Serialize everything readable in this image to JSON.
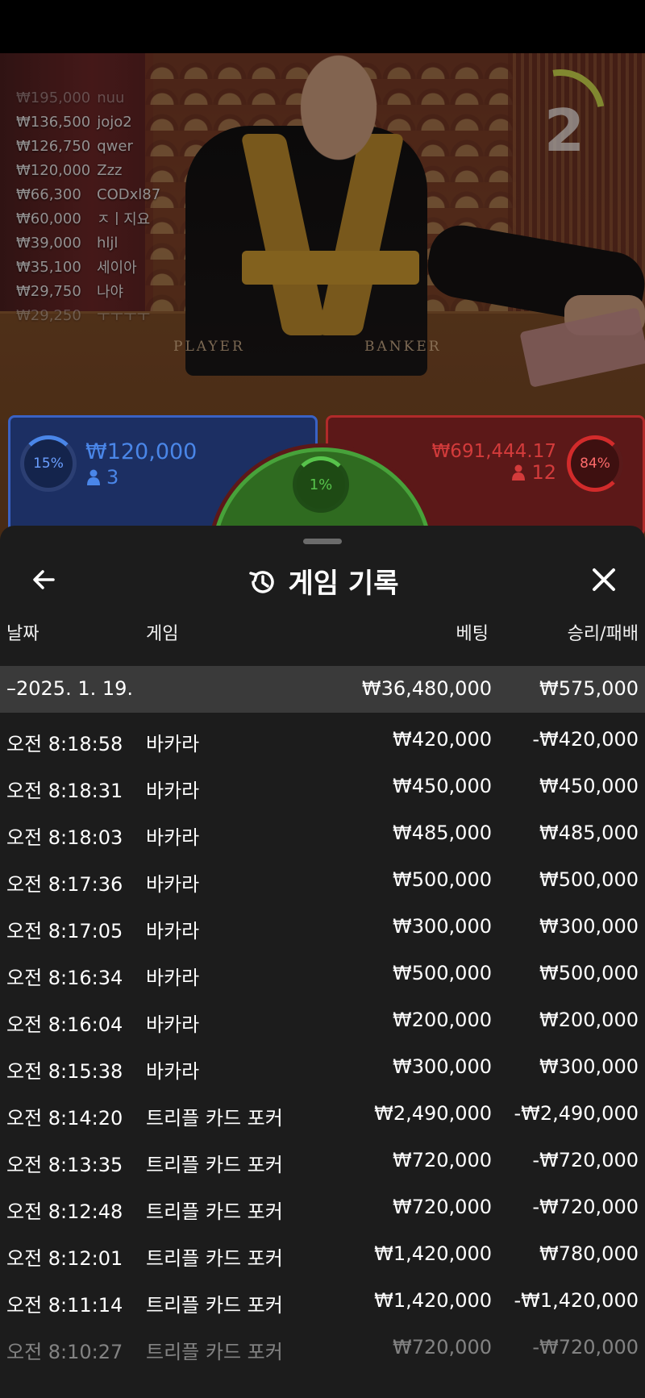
{
  "video": {
    "round_number": "2",
    "table_labels": {
      "player": "PLAYER",
      "banker": "BANKER"
    },
    "leaderboard": [
      {
        "amount": "₩195,000",
        "name": "nuu"
      },
      {
        "amount": "₩136,500",
        "name": "jojo2"
      },
      {
        "amount": "₩126,750",
        "name": "qwer"
      },
      {
        "amount": "₩120,000",
        "name": "Zzz"
      },
      {
        "amount": "₩66,300",
        "name": "CODxl87"
      },
      {
        "amount": "₩60,000",
        "name": "ㅈㅣ지요"
      },
      {
        "amount": "₩39,000",
        "name": "hljl"
      },
      {
        "amount": "₩35,100",
        "name": "세이아"
      },
      {
        "amount": "₩29,750",
        "name": "나야"
      },
      {
        "amount": "₩29,250",
        "name": "ㅜㅜㅜㅜ"
      }
    ],
    "player_panel": {
      "percent": "15%",
      "amount": "₩120,000",
      "count": "3",
      "color": "#4a86e8"
    },
    "banker_panel": {
      "percent": "84%",
      "amount": "₩691,444.17",
      "count": "12",
      "color": "#d33b3b"
    },
    "tie_panel": {
      "percent": "1%",
      "color": "#57c34b"
    }
  },
  "sheet": {
    "title": "게임 기록",
    "columns": {
      "date": "날짜",
      "game": "게임",
      "bet": "베팅",
      "win_loss": "승리/패배"
    },
    "summary": {
      "date": "–2025. 1. 19.",
      "bet": "₩36,480,000",
      "win_loss": "₩575,000"
    },
    "rows": [
      {
        "time": "오전 8:18:58",
        "game": "바카라",
        "bet": "₩420,000",
        "win_loss": "-₩420,000"
      },
      {
        "time": "오전 8:18:31",
        "game": "바카라",
        "bet": "₩450,000",
        "win_loss": "₩450,000"
      },
      {
        "time": "오전 8:18:03",
        "game": "바카라",
        "bet": "₩485,000",
        "win_loss": "₩485,000"
      },
      {
        "time": "오전 8:17:36",
        "game": "바카라",
        "bet": "₩500,000",
        "win_loss": "₩500,000"
      },
      {
        "time": "오전 8:17:05",
        "game": "바카라",
        "bet": "₩300,000",
        "win_loss": "₩300,000"
      },
      {
        "time": "오전 8:16:34",
        "game": "바카라",
        "bet": "₩500,000",
        "win_loss": "₩500,000"
      },
      {
        "time": "오전 8:16:04",
        "game": "바카라",
        "bet": "₩200,000",
        "win_loss": "₩200,000"
      },
      {
        "time": "오전 8:15:38",
        "game": "바카라",
        "bet": "₩300,000",
        "win_loss": "₩300,000"
      },
      {
        "time": "오전 8:14:20",
        "game": "트리플 카드 포커",
        "bet": "₩2,490,000",
        "win_loss": "-₩2,490,000"
      },
      {
        "time": "오전 8:13:35",
        "game": "트리플 카드 포커",
        "bet": "₩720,000",
        "win_loss": "-₩720,000"
      },
      {
        "time": "오전 8:12:48",
        "game": "트리플 카드 포커",
        "bet": "₩720,000",
        "win_loss": "-₩720,000"
      },
      {
        "time": "오전 8:12:01",
        "game": "트리플 카드 포커",
        "bet": "₩1,420,000",
        "win_loss": "₩780,000"
      },
      {
        "time": "오전 8:11:14",
        "game": "트리플 카드 포커",
        "bet": "₩1,420,000",
        "win_loss": "-₩1,420,000"
      },
      {
        "time": "오전 8:10:27",
        "game": "트리플 카드 포커",
        "bet": "₩720,000",
        "win_loss": "-₩720,000"
      }
    ]
  }
}
